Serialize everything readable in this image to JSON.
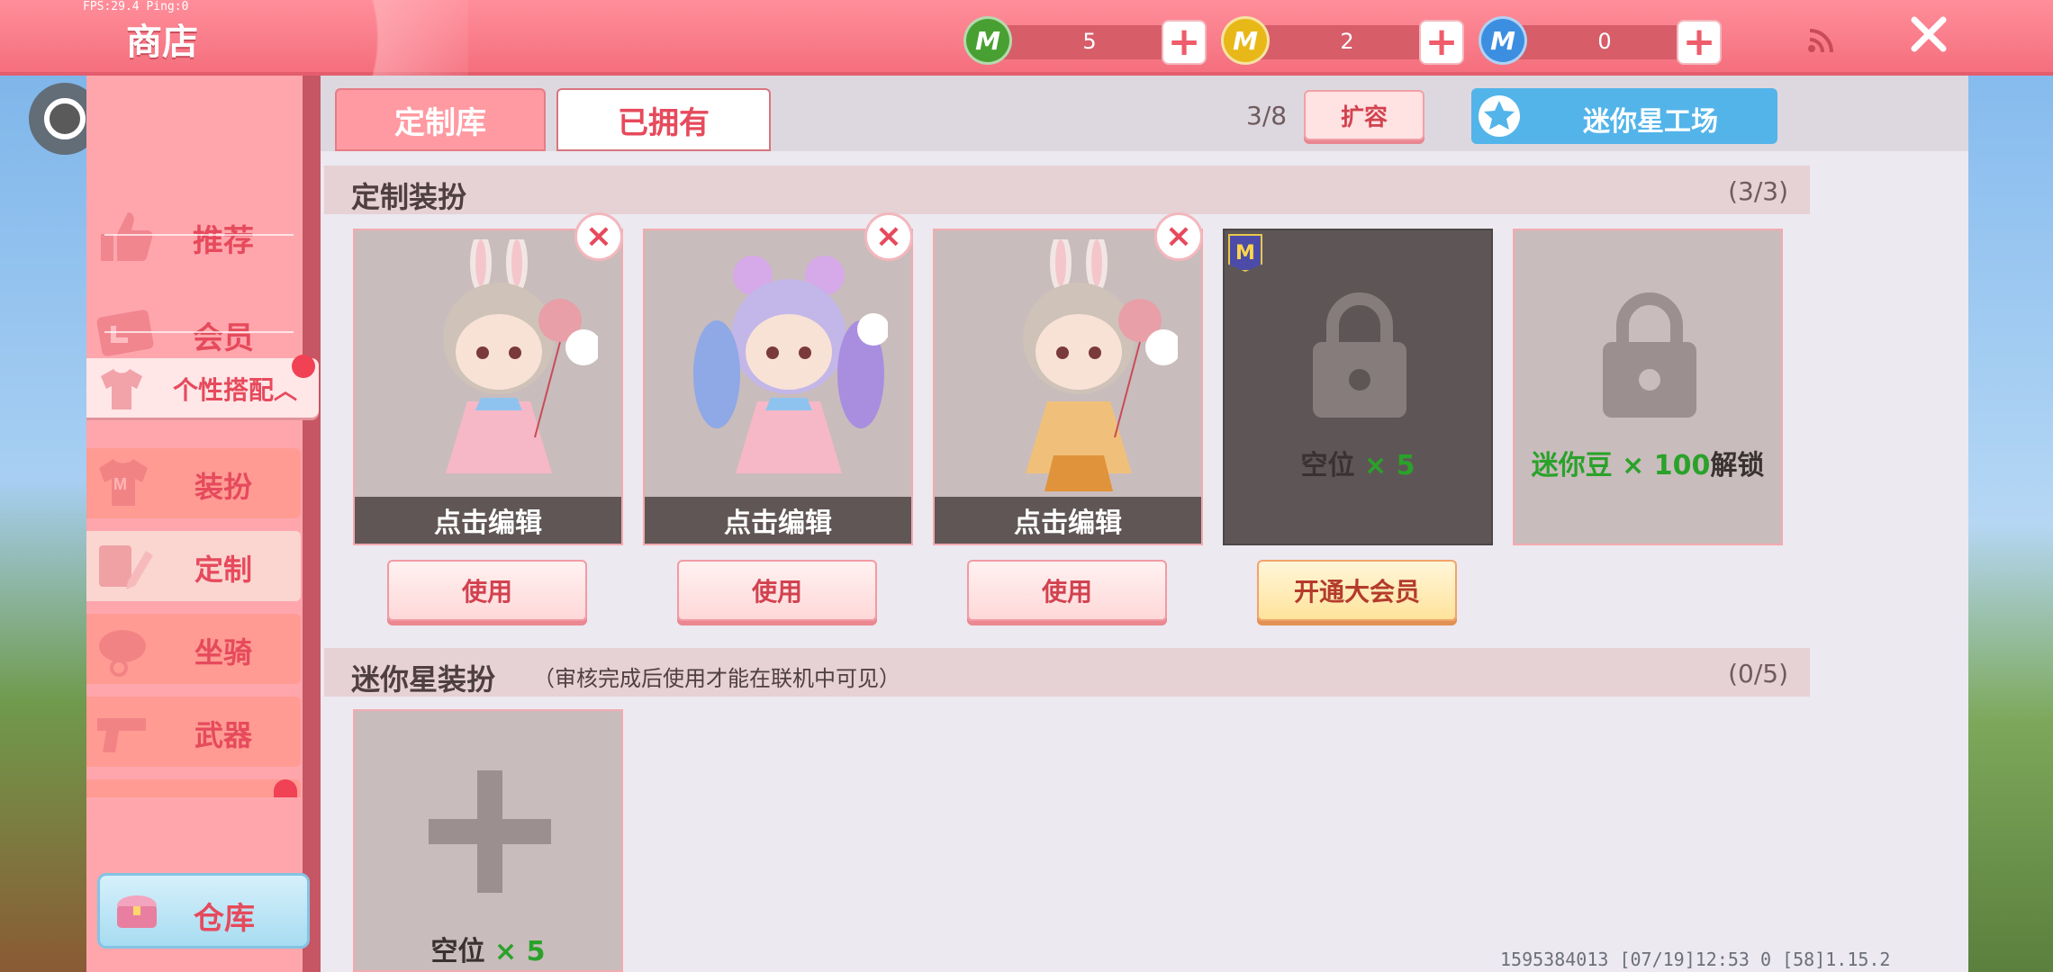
{
  "status": {
    "fps": "FPS:29.4  Ping:0"
  },
  "header": {
    "title": "商店",
    "currencies": [
      {
        "icon": "m-gem-green-icon",
        "symbol": "M",
        "value": "5",
        "color": "#48a032"
      },
      {
        "icon": "m-coin-gold-icon",
        "symbol": "M",
        "value": "2",
        "color": "#e8b818"
      },
      {
        "icon": "m-coin-blue-icon",
        "symbol": "M",
        "value": "0",
        "color": "#3c8fe0"
      }
    ],
    "plus_symbol": "+",
    "close_symbol": "×"
  },
  "sidebar": {
    "items": [
      {
        "label": "推荐",
        "icon": "thumbs-up-icon"
      },
      {
        "label": "会员",
        "icon": "vip-card-icon"
      }
    ],
    "group": {
      "label": "个性搭配",
      "arrow": "︿",
      "icon": "outfit-icon"
    },
    "sub_items": [
      {
        "label": "装扮",
        "icon": "shirt-icon"
      },
      {
        "label": "定制",
        "icon": "pencil-icon"
      },
      {
        "label": "坐骑",
        "icon": "mount-icon"
      },
      {
        "label": "武器",
        "icon": "gun-icon"
      }
    ],
    "warehouse": {
      "label": "仓库",
      "icon": "chest-icon"
    }
  },
  "tabs": {
    "custom": "定制库",
    "owned": "已拥有"
  },
  "capacity": "3/8",
  "expand_label": "扩容",
  "workshop_label": "迷你星工场",
  "custom_section": {
    "title": "定制装扮",
    "count": "(3/3)"
  },
  "cards": [
    {
      "edit_label": "点击编辑",
      "use_label": "使用",
      "outfit": "pink-dress",
      "delete_symbol": "×"
    },
    {
      "edit_label": "点击编辑",
      "use_label": "使用",
      "outfit": "pastel-twin-tails",
      "delete_symbol": "×"
    },
    {
      "edit_label": "点击编辑",
      "use_label": "使用",
      "outfit": "gold-dress",
      "delete_symbol": "×"
    }
  ],
  "locked_vip": {
    "text": "空位",
    "times": "× 5",
    "button": "开通大会员",
    "badge": "M"
  },
  "locked_beans": {
    "prefix": "迷你豆 × 100",
    "suffix": "解锁"
  },
  "star_section": {
    "title": "迷你星装扮",
    "note": "（审核完成后使用才能在联机中可见）",
    "count": "(0/5)"
  },
  "empty_slot": {
    "text": "空位",
    "times": "× 5"
  },
  "footer": {
    "info": "1595384013   [07/19]12:53 0   [58]1.15.2"
  }
}
